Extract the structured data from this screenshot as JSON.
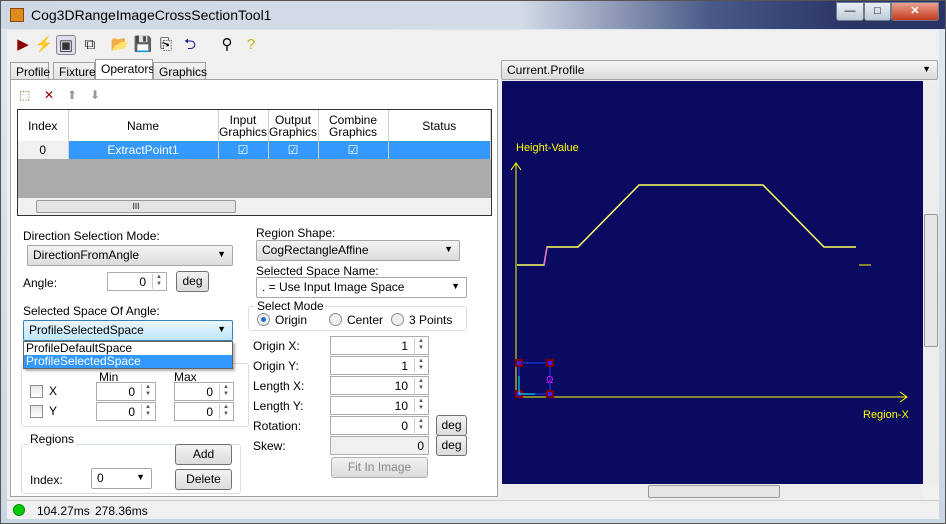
{
  "window": {
    "title": "Cog3DRangeImageCrossSectionTool1",
    "minimize": "—",
    "maximize": "□",
    "close": "✕"
  },
  "toolbar": [
    {
      "icon": "run-icon",
      "glyph": "▶",
      "color": "#8b0000"
    },
    {
      "icon": "lightning-icon",
      "glyph": "⚡",
      "color": "#e0c000"
    },
    {
      "icon": "show-image-icon",
      "glyph": "▣",
      "color": "#333"
    },
    {
      "icon": "floating-window-icon",
      "glyph": "⧉",
      "color": "#333"
    },
    {
      "icon": "open-icon",
      "glyph": "📂",
      "color": "#c8a000"
    },
    {
      "icon": "save-icon",
      "glyph": "💾",
      "color": "#000"
    },
    {
      "icon": "save-settings-icon",
      "glyph": "⎘",
      "color": "#000"
    },
    {
      "icon": "reset-icon",
      "glyph": "⮌",
      "color": "#1a1a9a"
    },
    {
      "icon": "graphics-tool-icon",
      "glyph": "⚲",
      "color": "#000"
    },
    {
      "icon": "help-icon",
      "glyph": "?",
      "color": "#d0b000"
    }
  ],
  "tabs": [
    "Profile",
    "Fixture",
    "Operators",
    "Graphics"
  ],
  "active_tab": "Operators",
  "ops_toolbar": {
    "add": "⬚",
    "delete": "✕",
    "up": "⬆",
    "down": "⬇"
  },
  "table": {
    "headers": [
      "Index",
      "Name",
      "Input Graphics",
      "Output Graphics",
      "Combine Graphics",
      "Status"
    ],
    "rows": [
      {
        "index": "0",
        "name": "ExtractPoint1",
        "input": true,
        "output": true,
        "combine": true,
        "status": ""
      }
    ],
    "scroll_grip": "III"
  },
  "direction": {
    "label": "Direction Selection Mode:",
    "value": "DirectionFromAngle",
    "angle_label": "Angle:",
    "angle": "0",
    "deg": "deg",
    "space_label": "Selected Space Of Angle:",
    "space_value": "ProfileSelectedSpace",
    "options": [
      "ProfileDefaultSpace",
      "ProfileSelectedSpace"
    ]
  },
  "range": {
    "min": "Min",
    "max": "Max",
    "x_label": "X",
    "y_label": "Y",
    "x_min": "0",
    "x_max": "0",
    "y_min": "0",
    "y_max": "0"
  },
  "regions": {
    "title": "Regions",
    "add": "Add",
    "delete": "Delete",
    "index_label": "Index:",
    "index": "0"
  },
  "region": {
    "shape_label": "Region Shape:",
    "shape": "CogRectangleAffine",
    "space_label": "Selected Space Name:",
    "space": ". = Use Input Image Space",
    "mode_title": "Select Mode",
    "modes": [
      "Origin",
      "Center",
      "3 Points"
    ],
    "mode": "Origin",
    "fields": [
      {
        "label": "Origin X:",
        "value": "1"
      },
      {
        "label": "Origin Y:",
        "value": "1"
      },
      {
        "label": "Length X:",
        "value": "10"
      },
      {
        "label": "Length Y:",
        "value": "10"
      },
      {
        "label": "Rotation:",
        "value": "0"
      },
      {
        "label": "Skew:",
        "value": "0"
      }
    ],
    "deg": "deg",
    "fit": "Fit In Image"
  },
  "display": {
    "selector": "Current.Profile",
    "y_axis": "Height-Value",
    "x_axis": "Region-X",
    "bg": "#0a0a60",
    "axis_color": "#ffff00"
  },
  "status": {
    "time1": "104.27ms",
    "time2": "278.36ms",
    "indicator": "#00cc00"
  }
}
